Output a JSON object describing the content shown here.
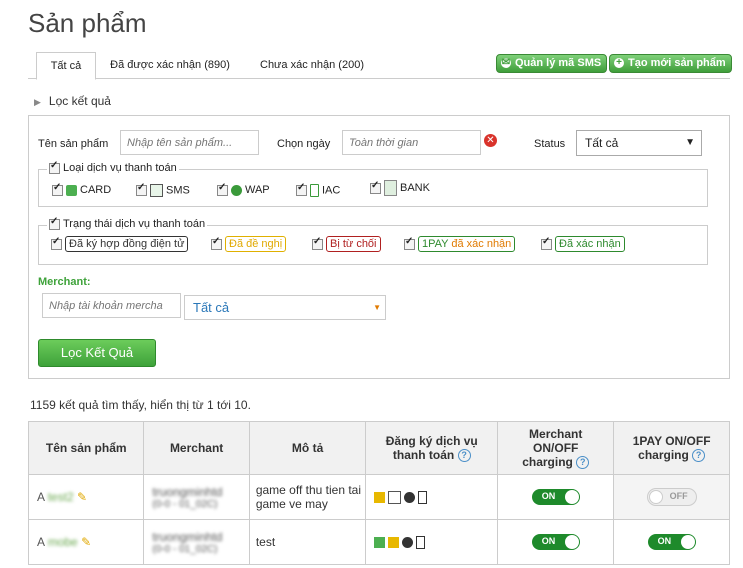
{
  "page_title": "Sản phẩm",
  "tabs": [
    {
      "label": "Tất cả",
      "active": true
    },
    {
      "label": "Đã được xác nhận (890)"
    },
    {
      "label": "Chưa xác nhận (200)"
    }
  ],
  "actions": {
    "sms": "Quản lý mã SMS",
    "new": "Tạo mới sản phẩm"
  },
  "filter_toggle": "Lọc kết quả",
  "filters": {
    "name_label": "Tên sản phẩm",
    "name_placeholder": "Nhập tên sản phẩm...",
    "date_label": "Chọn ngày",
    "date_placeholder": "Toàn thời gian",
    "status_label": "Status",
    "status_value": "Tất cả",
    "service_group": "Loại dịch vụ thanh toán",
    "services": [
      "CARD",
      "SMS",
      "WAP",
      "IAC",
      "BANK"
    ],
    "state_group": "Trạng thái dịch vụ thanh toán",
    "states": [
      "Đã ký hợp đồng điện tử",
      "Đã đề nghị",
      "Bị từ chối",
      "1PAY",
      "đã xác nhận",
      "Đã xác nhận"
    ],
    "merchant_label": "Merchant:",
    "merchant_placeholder": "Nhập tài khoản mercha",
    "merchant_select": "Tất cả",
    "submit": "Lọc Kết Quả"
  },
  "summary": "1159 kết quả tìm thấy, hiển thị từ 1 tới 10.",
  "table": {
    "headers": [
      "Tên sản phẩm",
      "Merchant",
      "Mô tả",
      "Đăng ký dịch vụ thanh toán",
      "Merchant ON/OFF charging",
      "1PAY ON/OFF charging"
    ],
    "rows": [
      {
        "name": "test2",
        "merchant": "truongminhtd",
        "merchant2": "(0-0 - 01_02C)",
        "desc": "game off thu tien tai game ve may",
        "m_toggle": "ON",
        "p_toggle": "OFF"
      },
      {
        "name": "mobe",
        "merchant": "truongminhtd",
        "merchant2": "(0-0 - 01_02C)",
        "desc": "test",
        "m_toggle": "ON",
        "p_toggle": "ON"
      }
    ]
  },
  "colors": {
    "accent_green": "#3ea23a",
    "toggle_on": "#1e8a2b",
    "link_blue": "#4a8fc8"
  }
}
